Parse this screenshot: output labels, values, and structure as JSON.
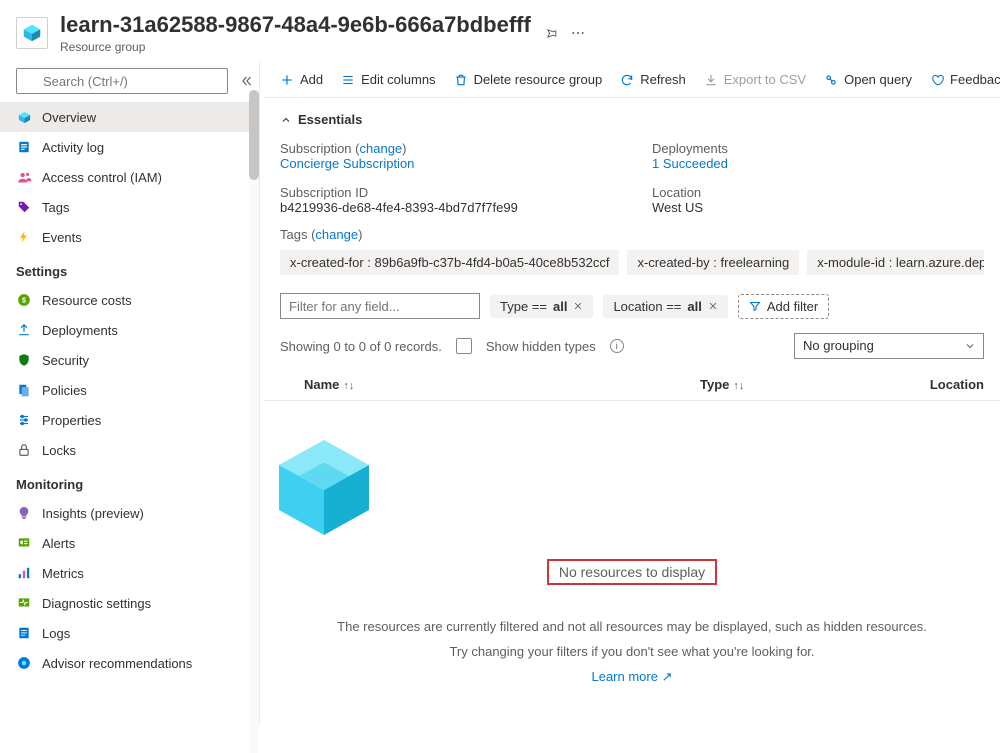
{
  "header": {
    "title": "learn-31a62588-9867-48a4-9e6b-666a7bdbefff",
    "subtitle": "Resource group"
  },
  "search": {
    "placeholder": "Search (Ctrl+/)"
  },
  "nav": {
    "overview": "Overview",
    "activity": "Activity log",
    "iam": "Access control (IAM)",
    "tags": "Tags",
    "events": "Events",
    "section_settings": "Settings",
    "costs": "Resource costs",
    "deployments": "Deployments",
    "security": "Security",
    "policies": "Policies",
    "properties": "Properties",
    "locks": "Locks",
    "section_monitoring": "Monitoring",
    "insights": "Insights (preview)",
    "alerts": "Alerts",
    "metrics": "Metrics",
    "diagnostic": "Diagnostic settings",
    "logs": "Logs",
    "advisor": "Advisor recommendations"
  },
  "toolbar": {
    "add": "Add",
    "edit_cols": "Edit columns",
    "delete_rg": "Delete resource group",
    "refresh": "Refresh",
    "export_csv": "Export to CSV",
    "open_query": "Open query",
    "feedback": "Feedback"
  },
  "essentials": {
    "toggle": "Essentials",
    "sub_label": "Subscription",
    "sub_change": "change",
    "sub_value": "Concierge Subscription",
    "dep_label": "Deployments",
    "dep_value": "1 Succeeded",
    "subid_label": "Subscription ID",
    "subid_value": "b4219936-de68-4fe4-8393-4bd7d7f7fe99",
    "loc_label": "Location",
    "loc_value": "West US",
    "tags_label": "Tags",
    "tags_change": "change",
    "tag1": "x-created-for : 89b6a9fb-c37b-4fd4-b0a5-40ce8b532ccf",
    "tag2": "x-created-by : freelearning",
    "tag3": "x-module-id : learn.azure.deploy-az"
  },
  "filters": {
    "placeholder": "Filter for any field...",
    "type_pre": "Type == ",
    "type_val": "all",
    "loc_pre": "Location == ",
    "loc_val": "all",
    "add": "Add filter"
  },
  "status": {
    "records": "Showing 0 to 0 of 0 records.",
    "hidden": "Show hidden types",
    "grouping": "No grouping"
  },
  "table": {
    "name": "Name",
    "type": "Type",
    "location": "Location"
  },
  "empty": {
    "headline": "No resources to display",
    "line1": "The resources are currently filtered and not all resources may be displayed, such as hidden resources.",
    "line2": "Try changing your filters if you don't see what you're looking for.",
    "learn": "Learn more"
  }
}
